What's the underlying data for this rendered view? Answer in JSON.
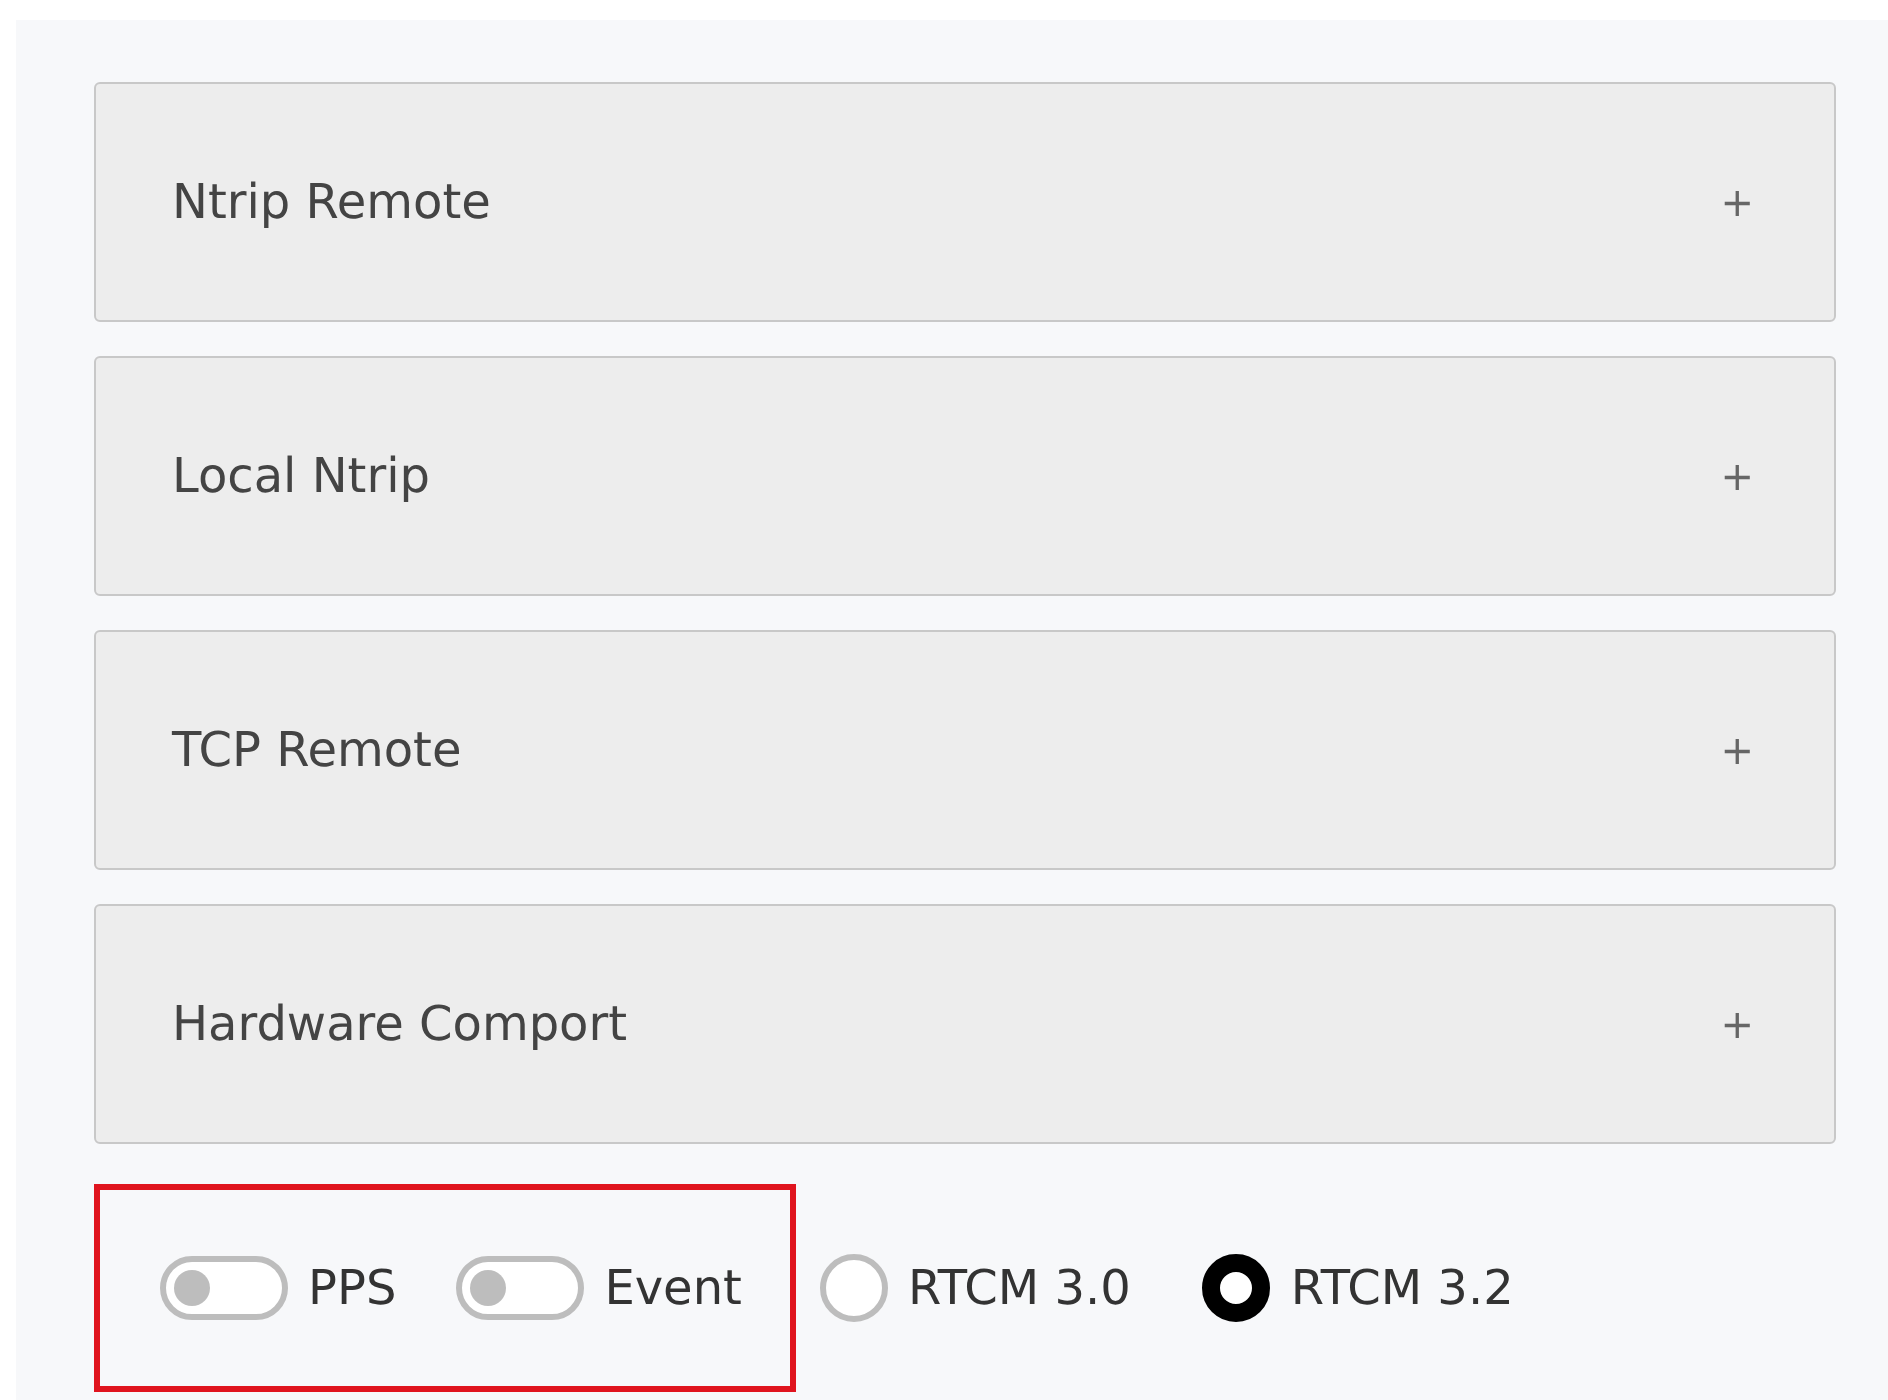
{
  "panels": [
    {
      "title": "Ntrip Remote",
      "icon": "+",
      "expanded": false
    },
    {
      "title": "Local Ntrip",
      "icon": "+",
      "expanded": false
    },
    {
      "title": "TCP Remote",
      "icon": "+",
      "expanded": false
    },
    {
      "title": "Hardware Comport",
      "icon": "+",
      "expanded": false
    }
  ],
  "toggles_highlighted": true,
  "toggles": [
    {
      "label": "PPS",
      "on": false
    },
    {
      "label": "Event",
      "on": false
    }
  ],
  "radios": [
    {
      "label": "RTCM 3.0",
      "selected": false
    },
    {
      "label": "RTCM 3.2",
      "selected": true
    }
  ]
}
